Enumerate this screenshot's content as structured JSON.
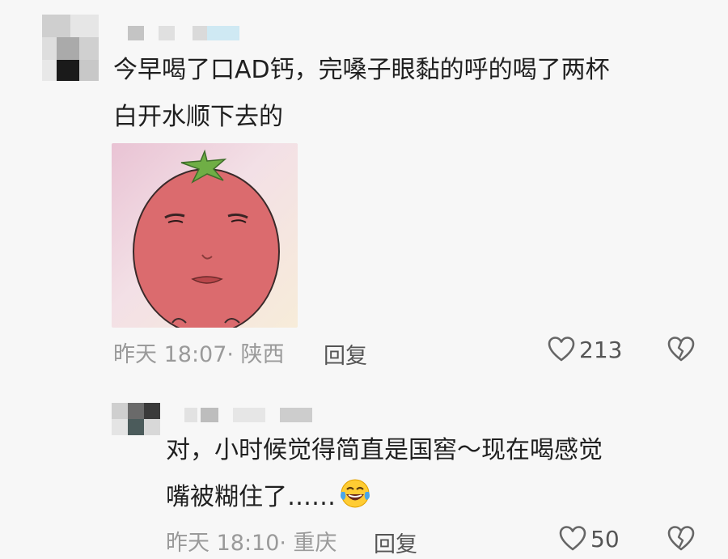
{
  "comments": [
    {
      "text_lines": [
        "今早喝了口AD钙，完嗓子眼黏的呼的喝了两杯",
        "白开水顺下去的"
      ],
      "time_location": "昨天 18:07· 陕西",
      "reply_label": "回复",
      "likes": "213",
      "sticker_icon": "tomato-face-sticker"
    },
    {
      "text_lines": [
        "对，小时候觉得简直是国窖～现在喝感觉",
        "嘴被糊住了……"
      ],
      "emoji": "laughing-tears-emoji",
      "time_location": "昨天 18:10· 重庆",
      "reply_label": "回复",
      "likes": "50"
    }
  ],
  "colors": {
    "text": "#1f1f1f",
    "meta": "#9a9a9a",
    "background": "#f7f7f7"
  }
}
